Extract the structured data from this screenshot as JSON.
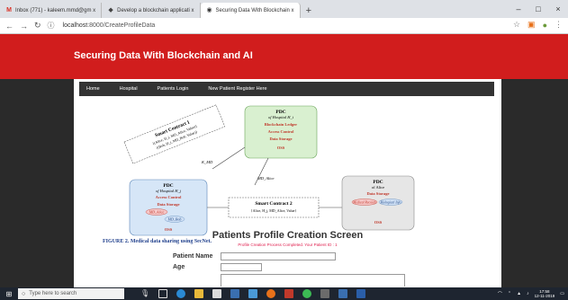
{
  "browser": {
    "tabs": [
      {
        "label": "Inbox (771) - kaleem.mmd@gm x",
        "icon": "gmail-icon",
        "active": false
      },
      {
        "label": "Develop a blockchain applicati x",
        "icon": "cube-icon",
        "active": false
      },
      {
        "label": "Securing Data With Blockchain x",
        "icon": "globe-icon",
        "active": true
      }
    ],
    "new_tab": "+",
    "url_host": "localhost",
    "url_path": ":8000/CreateProfileData",
    "win_min": "–",
    "win_max": "□",
    "win_close": "×"
  },
  "site": {
    "title": "Securing Data With Blockchain and AI",
    "nav": [
      "Home",
      "Hospital",
      "Patients Login",
      "New Patient Register Here"
    ]
  },
  "figure": {
    "smart_contract_1": "Smart Contract 1",
    "sc1_line1": "{(Alice, H_i, MD_Alice, Value)}",
    "sc1_line2": "{(Bob, H_i, MD_Bob, Value)}",
    "k_md": "K_MD",
    "md_alice": "MD_Alice",
    "pdc_i_title": "PDC",
    "pdc_i_sub": "of Hospital H_i",
    "pdc_i_items": [
      "Blockchain Ledger",
      "Access Control",
      "Data Storage",
      "OSS"
    ],
    "pdc_j_title": "PDC",
    "pdc_j_sub": "of Hospital H_j",
    "pdc_j_items": [
      "Access Control",
      "Data Storage",
      "MD_Alice",
      "MD_Bob",
      "OSS"
    ],
    "smart_contract_2": "Smart Contract 2",
    "sc2_line": "{Alice, H_j, MD_Alice, Value}",
    "pdc_a_title": "PDC",
    "pdc_a_sub": "of Alice",
    "pdc_a_items": [
      "Data Storage",
      "Medical Records",
      "Biological Info",
      "OSS"
    ],
    "caption": "FIGURE 2.   Medical data sharing using SecNet."
  },
  "form": {
    "title": "Patients Profile Creation Screen",
    "message": "Profile Creation Process Completed. Your Patient ID : 1",
    "patient_name_label": "Patient Name",
    "age_label": "Age",
    "patient_name_value": "",
    "age_value": ""
  },
  "taskbar": {
    "search_placeholder": "Type here to search",
    "time": "17:58",
    "date": "12-11-2019"
  },
  "colors": {
    "header_red": "#d11d1d",
    "dark_side": "#2a2a2a",
    "nav_bg": "#333333",
    "message_pink": "#e0204f",
    "pdc_green": "#d9f0d0",
    "pdc_blue": "#d6e6f7",
    "pdc_grey": "#e6e6e6"
  }
}
